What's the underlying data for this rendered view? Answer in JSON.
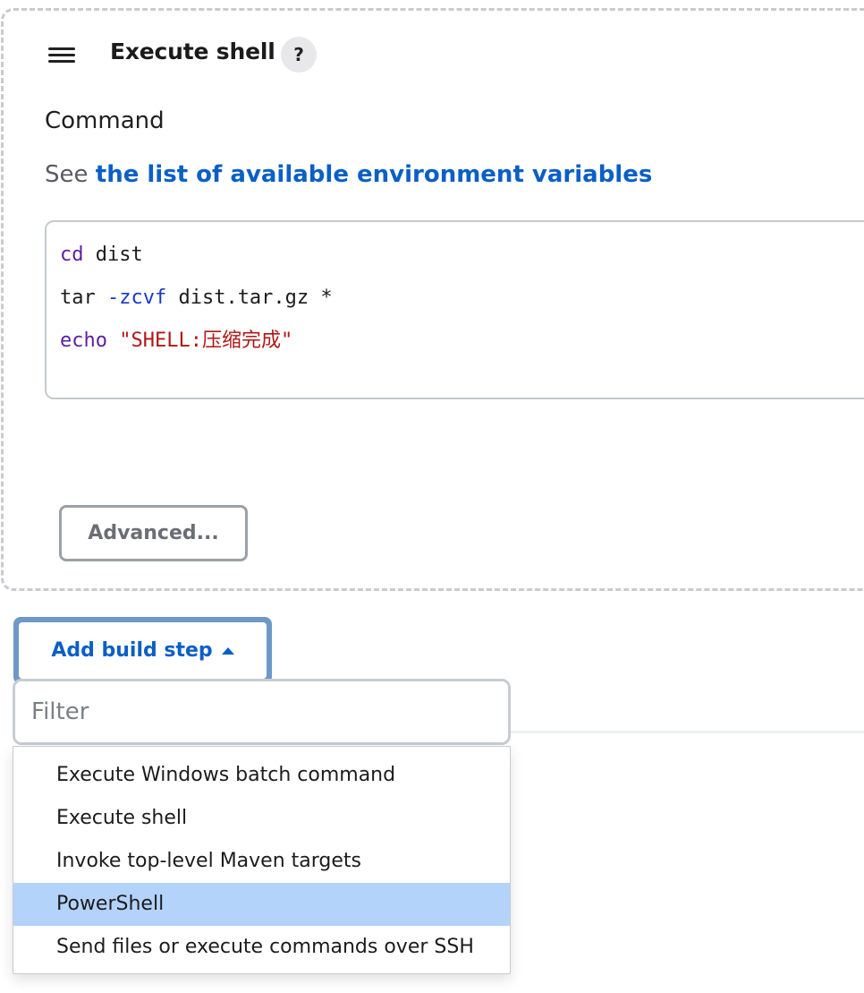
{
  "step": {
    "title": "Execute shell",
    "help": "?",
    "command_label": "Command",
    "env_prefix": "See",
    "env_link": "the list of available environment variables",
    "code": {
      "line1_kw": "cd",
      "line1_rest": " dist",
      "line2_cmd": "tar ",
      "line2_flag": "-zcvf",
      "line2_rest": " dist.tar.gz *",
      "line3_kw": "echo",
      "line3_space": " ",
      "line3_str": "\"SHELL:压缩完成\""
    },
    "advanced_label": "Advanced..."
  },
  "add_build_step": {
    "label": "Add build step"
  },
  "filter": {
    "placeholder": "Filter",
    "value": ""
  },
  "menu": {
    "items": [
      "Execute Windows batch command",
      "Execute shell",
      "Invoke top-level Maven targets",
      "PowerShell",
      "Send files or execute commands over SSH"
    ],
    "selected": "PowerShell"
  },
  "colors": {
    "link": "#0a5fc7",
    "selected_bg": "#b3d3fb",
    "keyword": "#5c1fa0",
    "string": "#b11616"
  }
}
